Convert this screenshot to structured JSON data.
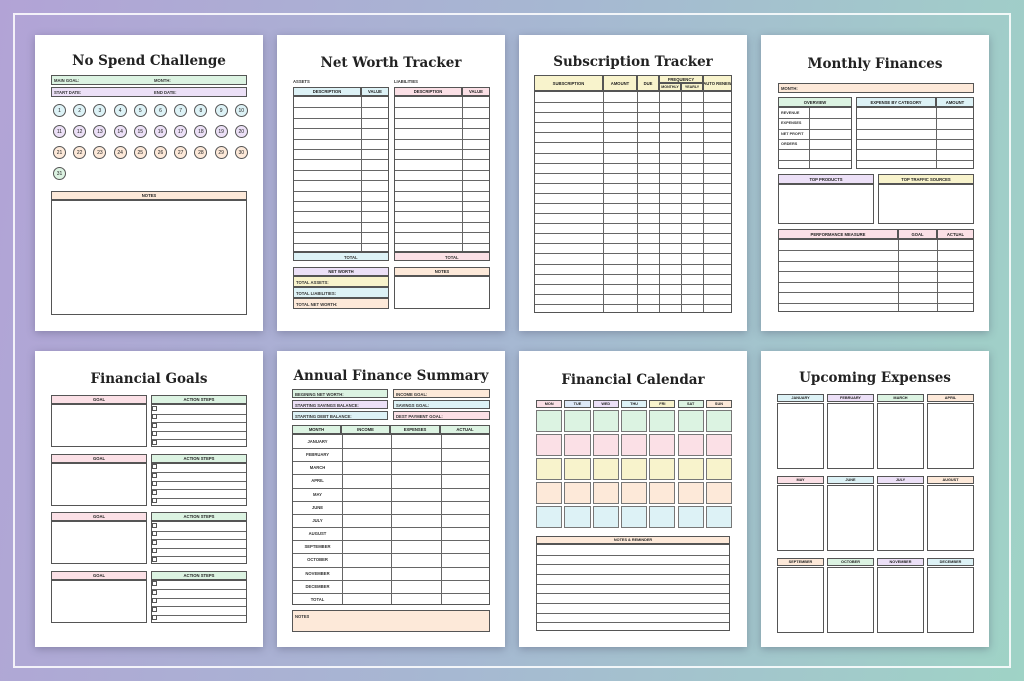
{
  "colors": {
    "mint": "#dcf3e2",
    "pink": "#fbe0e6",
    "peach": "#fde9d9",
    "lilac": "#ece0f7",
    "sky": "#ddf2f6",
    "yellow": "#f8f3cc",
    "blue": "#dde9f8"
  },
  "no_spend": {
    "title": "No Spend Challenge",
    "main_goal": "MAIN GOAL:",
    "month": "MONTH:",
    "start_date": "START DATE:",
    "end_date": "END DATE:",
    "days": [
      "1",
      "2",
      "3",
      "4",
      "5",
      "6",
      "7",
      "8",
      "9",
      "10",
      "11",
      "12",
      "13",
      "14",
      "15",
      "16",
      "17",
      "18",
      "19",
      "20",
      "21",
      "22",
      "23",
      "24",
      "25",
      "26",
      "27",
      "28",
      "29",
      "30",
      "31"
    ],
    "notes": "NOTES"
  },
  "net_worth": {
    "title": "Net Worth Tracker",
    "assets": "ASSETS",
    "liabilities": "LIABILITIES",
    "description": "DESCRIPTION",
    "value": "VALUE",
    "total": "TOTAL",
    "net_worth": "NET WORTH",
    "total_assets": "TOTAL ASSETS:",
    "total_liabilities": "TOTAL LIABILITIES:",
    "total_net_worth": "TOTAL NET WORTH:",
    "notes": "NOTES"
  },
  "subscription": {
    "title": "Subscription Tracker",
    "subscription": "SUBSCRIPTION",
    "amount": "AMOUNT",
    "due": "DUE",
    "frequency": "FREQUENCY",
    "monthly": "MONTHLY",
    "yearly": "YEARLY",
    "auto_renew": "AUTO RENEW"
  },
  "monthly": {
    "title": "Monthly Finances",
    "month": "MONTH:",
    "overview": "OVERVIEW",
    "overview_rows": [
      "REVENUE",
      "EXPENSES",
      "NET PROFIT",
      "ORDERS"
    ],
    "expense_by_category": "EXPENSE BY CATEGORY",
    "amount": "AMOUNT",
    "top_products": "TOP PRODUCTS",
    "top_traffic": "TOP TRAFFIC SOURCES",
    "performance": "PERFORMANCE MEASURE",
    "goal": "GOAL",
    "actual": "ACTUAL"
  },
  "goals": {
    "title": "Financial Goals",
    "goal": "GOAL",
    "action_steps": "ACTION STEPS"
  },
  "annual": {
    "title": "Annual Finance Summary",
    "begining": "BEGINING NET WORTH:",
    "starting_savings": "STARTING SAVINGS BALANCE:",
    "starting_debt": "STARTING DEBT BALANCE:",
    "income_goal": "INCOME GOAL:",
    "savings_goal": "SAVINGS GOAL:",
    "debt_goal": "DEST PAYMENT GOAL:",
    "month": "MONTH",
    "income": "INCOME",
    "expenses": "EXPENSES",
    "actual": "ACTUAL",
    "months": [
      "JANUARY",
      "FEBRUARY",
      "MARCH",
      "APRIL",
      "MAY",
      "JUNE",
      "JULY",
      "AUGUST",
      "SEPTEMBER",
      "OCTOBER",
      "NOVEMBER",
      "DECEMBER",
      "TOTAL"
    ],
    "notes": "NOTES"
  },
  "calendar": {
    "title": "Financial Calendar",
    "days": [
      "MON",
      "TUE",
      "WED",
      "THU",
      "FRI",
      "SAT",
      "SUN"
    ],
    "notes": "NOTES & REMINDER"
  },
  "upcoming": {
    "title": "Upcoming Expenses",
    "months": [
      "JANUARY",
      "FEBRUARY",
      "MARCH",
      "APRIL",
      "MAY",
      "JUNE",
      "JULY",
      "AUGUST",
      "SEPTEMBER",
      "OCTOBER",
      "NOVEMBER",
      "DECEMBER"
    ]
  }
}
